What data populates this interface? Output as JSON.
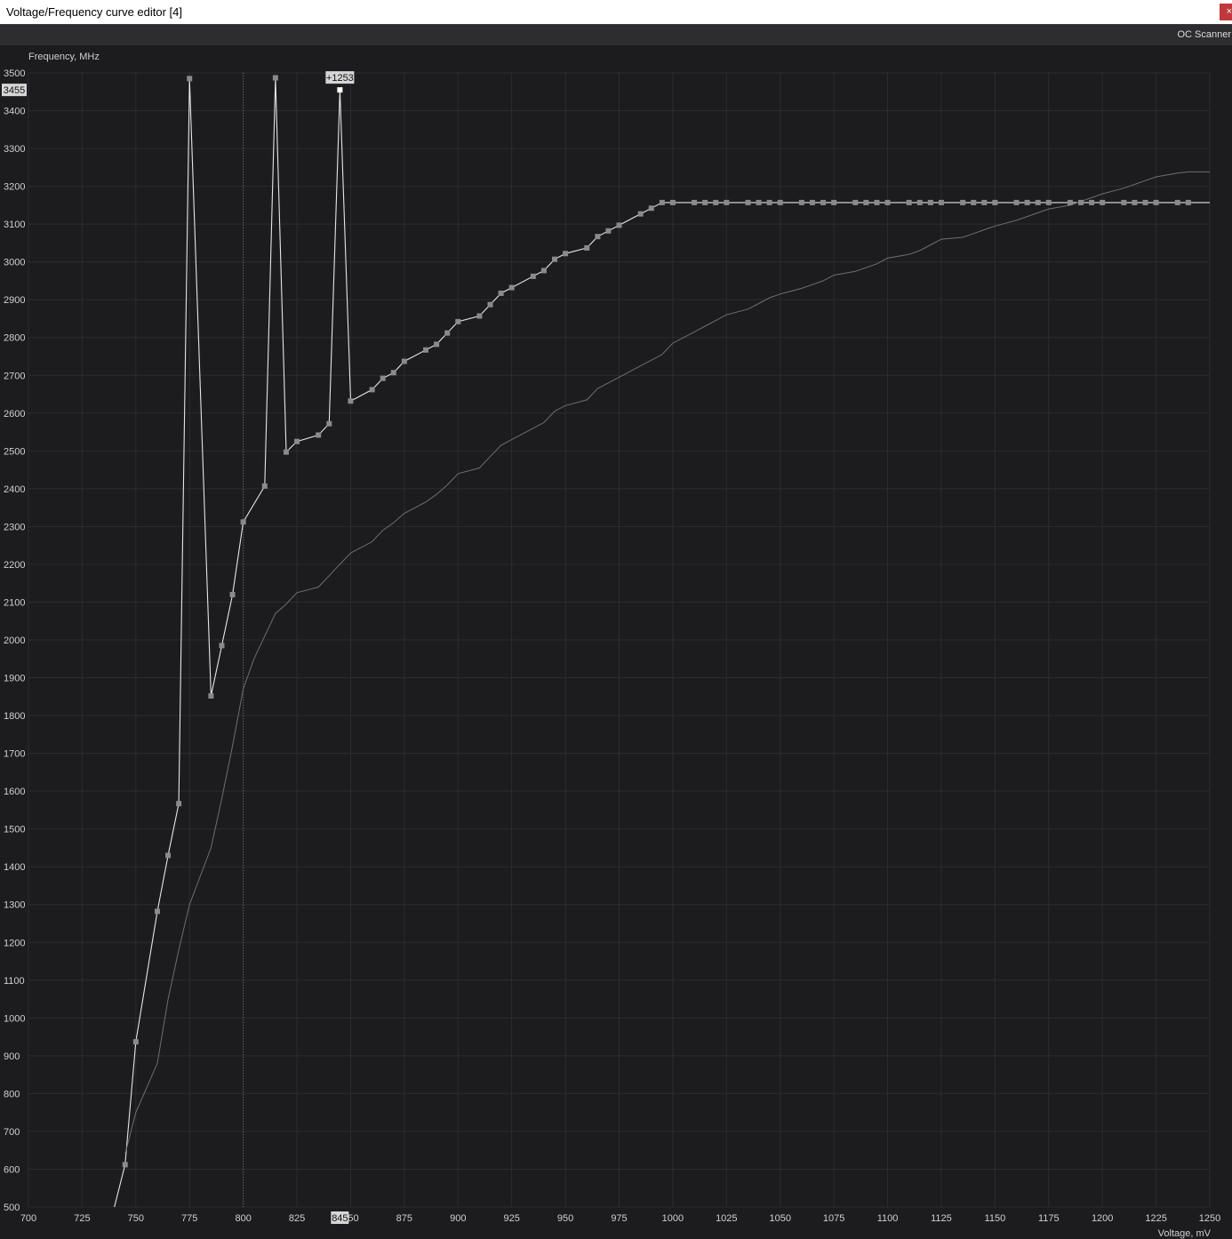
{
  "window": {
    "title": "Voltage/Frequency curve editor [4]",
    "close_label": "×"
  },
  "toolbar": {
    "oc_scanner_label": "OC Scanner"
  },
  "chart_data": {
    "type": "line",
    "xlabel": "Voltage, mV",
    "ylabel": "Frequency, MHz",
    "xlim": [
      700,
      1250
    ],
    "ylim": [
      500,
      3500
    ],
    "grid": true,
    "x_ticks": [
      700,
      725,
      750,
      775,
      800,
      825,
      850,
      875,
      900,
      925,
      950,
      975,
      1000,
      1025,
      1050,
      1075,
      1100,
      1125,
      1150,
      1175,
      1200,
      1225,
      1250
    ],
    "y_ticks": [
      500,
      600,
      700,
      800,
      900,
      1000,
      1100,
      1200,
      1300,
      1400,
      1500,
      1600,
      1700,
      1800,
      1900,
      2000,
      2100,
      2200,
      2300,
      2400,
      2500,
      2600,
      2700,
      2800,
      2900,
      3000,
      3100,
      3200,
      3300,
      3400,
      3500
    ],
    "cursor": {
      "voltage": 845,
      "frequency": 3455,
      "voltage_label": "845",
      "frequency_label": "3455",
      "offset_label": "+1253"
    },
    "reference_line_x": 800,
    "series": [
      {
        "style": "edited",
        "markers": true,
        "x": [
          740,
          745,
          750,
          760,
          765,
          770,
          775,
          785,
          790,
          795,
          800,
          810,
          815,
          820,
          825,
          835,
          840,
          845,
          850,
          860,
          865,
          870,
          875,
          885,
          890,
          895,
          900,
          910,
          915,
          920,
          925,
          935,
          940,
          945,
          950,
          960,
          965,
          970,
          975,
          985,
          990,
          995,
          1000,
          1010,
          1015,
          1020,
          1025,
          1035,
          1040,
          1045,
          1050,
          1060,
          1065,
          1070,
          1075,
          1085,
          1090,
          1095,
          1100,
          1110,
          1115,
          1120,
          1125,
          1135,
          1140,
          1145,
          1150,
          1160,
          1165,
          1170,
          1175,
          1185,
          1190,
          1195,
          1200,
          1210,
          1215,
          1220,
          1225,
          1235,
          1240,
          1250
        ],
        "y": [
          500,
          612,
          937,
          1282,
          1430,
          1567,
          3485,
          1852,
          1985,
          2120,
          2312,
          2407,
          3487,
          2497,
          2525,
          2542,
          2572,
          3455,
          2632,
          2662,
          2692,
          2707,
          2737,
          2767,
          2782,
          2812,
          2842,
          2857,
          2887,
          2917,
          2932,
          2962,
          2977,
          3007,
          3022,
          3037,
          3067,
          3082,
          3097,
          3127,
          3142,
          3157,
          3157,
          3157,
          3157,
          3157,
          3157,
          3157,
          3157,
          3157,
          3157,
          3157,
          3157,
          3157,
          3157,
          3157,
          3157,
          3157,
          3157,
          3157,
          3157,
          3157,
          3157,
          3157,
          3157,
          3157,
          3157,
          3157,
          3157,
          3157,
          3157,
          3157,
          3157,
          3157,
          3157,
          3157,
          3157,
          3157,
          3157,
          3157,
          3157,
          3157
        ]
      },
      {
        "style": "default",
        "markers": false,
        "x": [
          745,
          750,
          760,
          765,
          770,
          775,
          785,
          790,
          795,
          800,
          805,
          810,
          815,
          820,
          825,
          835,
          840,
          845,
          850,
          860,
          865,
          870,
          875,
          885,
          890,
          895,
          900,
          910,
          915,
          920,
          925,
          935,
          940,
          945,
          950,
          960,
          965,
          970,
          975,
          985,
          990,
          995,
          1000,
          1010,
          1015,
          1020,
          1025,
          1035,
          1040,
          1045,
          1050,
          1060,
          1065,
          1070,
          1075,
          1085,
          1090,
          1095,
          1100,
          1110,
          1115,
          1120,
          1125,
          1135,
          1140,
          1145,
          1150,
          1160,
          1165,
          1170,
          1175,
          1185,
          1190,
          1195,
          1200,
          1210,
          1215,
          1220,
          1225,
          1235,
          1240,
          1250
        ],
        "y": [
          640,
          750,
          880,
          1050,
          1180,
          1300,
          1450,
          1580,
          1720,
          1870,
          1950,
          2010,
          2070,
          2095,
          2125,
          2140,
          2170,
          2200,
          2230,
          2260,
          2290,
          2310,
          2335,
          2365,
          2385,
          2410,
          2440,
          2455,
          2485,
          2515,
          2530,
          2560,
          2575,
          2605,
          2620,
          2635,
          2665,
          2680,
          2695,
          2725,
          2740,
          2755,
          2785,
          2815,
          2830,
          2845,
          2860,
          2875,
          2890,
          2905,
          2915,
          2930,
          2940,
          2950,
          2965,
          2975,
          2985,
          2995,
          3010,
          3020,
          3030,
          3045,
          3060,
          3065,
          3075,
          3085,
          3095,
          3110,
          3120,
          3130,
          3140,
          3150,
          3160,
          3170,
          3180,
          3195,
          3205,
          3215,
          3225,
          3235,
          3238,
          3238
        ]
      }
    ]
  }
}
